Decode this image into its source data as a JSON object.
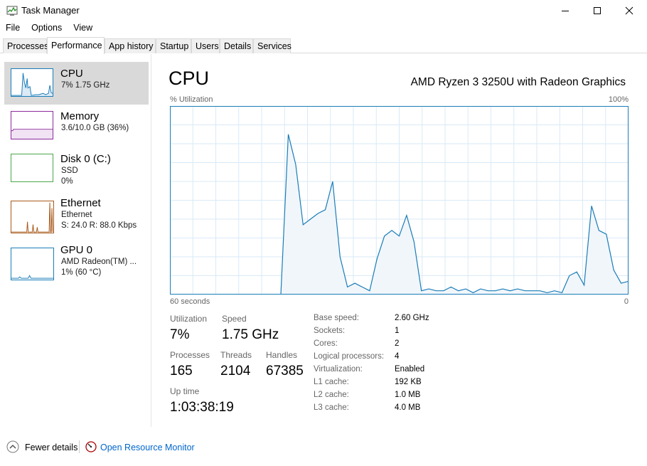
{
  "window": {
    "title": "Task Manager"
  },
  "menu": [
    "File",
    "Options",
    "View"
  ],
  "tabs": [
    "Processes",
    "Performance",
    "App history",
    "Startup",
    "Users",
    "Details",
    "Services"
  ],
  "active_tab": "Performance",
  "sidebar": [
    {
      "title": "CPU",
      "line1": "7%  1.75 GHz",
      "line2": ""
    },
    {
      "title": "Memory",
      "line1": "3.6/10.0 GB (36%)",
      "line2": ""
    },
    {
      "title": "Disk 0 (C:)",
      "line1": "SSD",
      "line2": "0%"
    },
    {
      "title": "Ethernet",
      "line1": "Ethernet",
      "line2": "S: 24.0  R: 88.0 Kbps"
    },
    {
      "title": "GPU 0",
      "line1": "AMD Radeon(TM) ...",
      "line2": "1% (60 °C)"
    }
  ],
  "main": {
    "title": "CPU",
    "cpu_name": "AMD Ryzen 3 3250U with Radeon Graphics",
    "util_label": "% Utilization",
    "util_max": "100%",
    "time_label": "60 seconds",
    "zero_label": "0"
  },
  "stats": {
    "utilization_label": "Utilization",
    "utilization": "7%",
    "speed_label": "Speed",
    "speed": "1.75 GHz",
    "processes_label": "Processes",
    "processes": "165",
    "threads_label": "Threads",
    "threads": "2104",
    "handles_label": "Handles",
    "handles": "67385",
    "uptime_label": "Up time",
    "uptime": "1:03:38:19"
  },
  "details": [
    {
      "label": "Base speed:",
      "value": "2.60 GHz"
    },
    {
      "label": "Sockets:",
      "value": "1"
    },
    {
      "label": "Cores:",
      "value": "2"
    },
    {
      "label": "Logical processors:",
      "value": "4"
    },
    {
      "label": "Virtualization:",
      "value": "Enabled"
    },
    {
      "label": "L1 cache:",
      "value": "192 KB"
    },
    {
      "label": "L2 cache:",
      "value": "1.0 MB"
    },
    {
      "label": "L3 cache:",
      "value": "4.0 MB"
    }
  ],
  "footer": {
    "fewer_details": "Fewer details",
    "open_resource_monitor": "Open Resource Monitor"
  },
  "colors": {
    "cpu_line": "#1a7db8",
    "cpu_fill": "#f1f6fb",
    "memory": "#8b2b9b",
    "disk": "#4ca64c",
    "ethernet": "#a7591b",
    "gpu": "#1a7db8"
  },
  "chart_data": {
    "type": "area",
    "ylim": [
      0,
      100
    ],
    "x_seconds_ago": [
      60,
      59,
      58,
      57,
      56,
      55,
      54,
      53,
      52,
      51,
      50,
      49,
      48,
      47,
      46,
      45,
      44,
      43,
      42,
      41,
      40,
      39,
      38,
      37,
      36,
      35,
      34,
      33,
      32,
      31,
      30,
      29,
      28,
      27,
      26,
      25,
      24,
      23,
      22,
      21,
      20,
      19,
      18,
      17,
      16,
      15,
      14,
      13,
      12,
      11,
      10,
      9,
      8,
      7,
      6,
      5,
      4,
      3,
      2,
      1,
      0
    ],
    "values": [
      0,
      0,
      0,
      0,
      0,
      0,
      0,
      0,
      0,
      0,
      0,
      0,
      0,
      0,
      0,
      0,
      85,
      69,
      37,
      40,
      43,
      45,
      60,
      20,
      4,
      6,
      4,
      2,
      19,
      31,
      34,
      31,
      42,
      28,
      2,
      3,
      2,
      2,
      4,
      2,
      3,
      1,
      3,
      2,
      2,
      3,
      2,
      3,
      2,
      2,
      2,
      1,
      2,
      1,
      10,
      12,
      5,
      47,
      34,
      32,
      13,
      6,
      7
    ]
  }
}
